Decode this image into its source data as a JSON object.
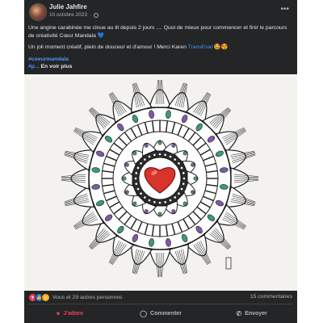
{
  "post": {
    "author": "Julie Jahfire",
    "date": "10 octobre 2023",
    "date_separator": "·",
    "more_icon": "more-horizontal-icon",
    "paragraph1": "Une angine carabinée me cloue au lit depuis 2 jours .... Quoi de mieux pour commencer et finir le parcours de créativité Cœur Mandala",
    "paragraph1_emoji": "💙",
    "paragraph2_text": "Un joli moment créatif, plein de douceur et d'amour ! Merci Karen",
    "paragraph2_mention": "TransEval",
    "paragraph2_emoji": "🤩😍",
    "hashtag1": "#coeurmandala",
    "hashtag2": "#p...",
    "see_more": "En voir plus"
  },
  "image": {
    "subject": "mandala drawing with red heart",
    "accent_colors": [
      "#d8342b",
      "#7e5aa8",
      "#3c9a78",
      "#1c1c1c"
    ]
  },
  "stats": {
    "reaction_icons": [
      "love",
      "like",
      "care"
    ],
    "reactions_text": "Vous et 29 autres personnes",
    "comments_text": "15 commentaires"
  },
  "actions": {
    "love_label": "J'adore",
    "comment_label": "Commenter",
    "share_label": "Envoyer"
  },
  "colors": {
    "card_bg": "#242526",
    "text": "#e4e6eb",
    "muted": "#b0b3b8",
    "link": "#4599ff",
    "love": "#f33e58"
  }
}
